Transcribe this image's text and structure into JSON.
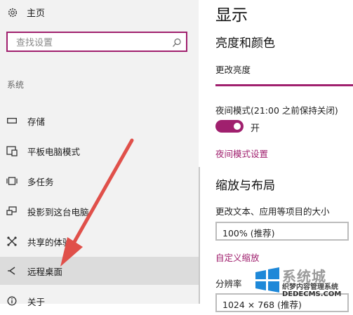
{
  "sidebar": {
    "home_label": "主页",
    "search_placeholder": "查找设置",
    "section_label": "系统",
    "items": [
      {
        "label": "存储",
        "icon": "storage-icon"
      },
      {
        "label": "平板电脑模式",
        "icon": "tablet-mode-icon"
      },
      {
        "label": "多任务",
        "icon": "multitasking-icon"
      },
      {
        "label": "投影到这台电脑",
        "icon": "project-icon"
      },
      {
        "label": "共享的体验",
        "icon": "shared-experiences-icon"
      },
      {
        "label": "远程桌面",
        "icon": "remote-desktop-icon",
        "selected": true
      },
      {
        "label": "关于",
        "icon": "about-icon"
      }
    ]
  },
  "main": {
    "title": "显示",
    "brightness_heading": "亮度和颜色",
    "brightness_label": "更改亮度",
    "night_label": "夜间模式(21:00 之前保持关闭)",
    "night_state": "开",
    "night_settings_link": "夜间模式设置",
    "scale_heading": "缩放与布局",
    "scale_label": "更改文本、应用等项目的大小",
    "scale_value": "100% (推荐)",
    "custom_scale_link": "自定义缩放",
    "resolution_label": "分辨率",
    "resolution_value": "1024 × 768 (推荐)"
  },
  "watermark": {
    "title": "系统城",
    "subtitle": "织梦内容管理系统",
    "url": "DEDECMS.COM"
  },
  "colors": {
    "accent": "#a0206e",
    "sidebar_bg": "#f2f2f2",
    "selected_bg": "#dcdcdc",
    "arrow": "#e0504a"
  }
}
